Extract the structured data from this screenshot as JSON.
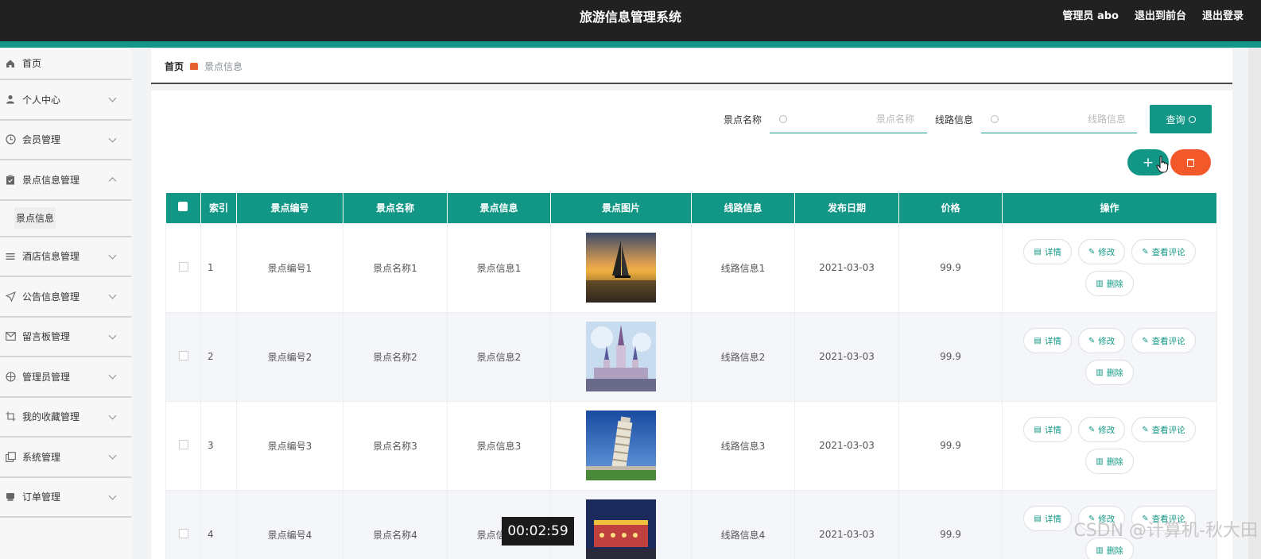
{
  "header": {
    "title": "旅游信息管理系统",
    "user_label": "管理员 abo",
    "front_label": "退出到前台",
    "logout_label": "退出登录"
  },
  "sidebar": {
    "items": [
      {
        "label": "首页",
        "icon": "home-icon"
      },
      {
        "label": "个人中心",
        "icon": "user-icon"
      },
      {
        "label": "会员管理",
        "icon": "clock-icon"
      },
      {
        "label": "景点信息管理",
        "icon": "clipboard-icon"
      },
      {
        "label": "酒店信息管理",
        "icon": "list-icon"
      },
      {
        "label": "公告信息管理",
        "icon": "send-icon"
      },
      {
        "label": "留言板管理",
        "icon": "mail-icon"
      },
      {
        "label": "管理员管理",
        "icon": "compass-icon"
      },
      {
        "label": "我的收藏管理",
        "icon": "crop-icon"
      },
      {
        "label": "系统管理",
        "icon": "copy-icon"
      },
      {
        "label": "订单管理",
        "icon": "printer-icon"
      }
    ],
    "submenu": {
      "label": "景点信息"
    }
  },
  "breadcrumb": {
    "home": "首页",
    "current": "景点信息"
  },
  "search": {
    "name_label": "景点名称",
    "name_placeholder": "景点名称",
    "route_label": "线路信息",
    "route_placeholder": "线路信息",
    "query_label": "查询"
  },
  "toolbar": {
    "add_label": "+"
  },
  "table": {
    "headers": [
      "索引",
      "景点编号",
      "景点名称",
      "景点信息",
      "景点图片",
      "线路信息",
      "发布日期",
      "价格",
      "操作"
    ],
    "rows": [
      {
        "index": "1",
        "code": "景点编号1",
        "name": "景点名称1",
        "info": "景点信息1",
        "image": "sunset-sailboat",
        "route": "线路信息1",
        "date": "2021-03-03",
        "price": "99.9"
      },
      {
        "index": "2",
        "code": "景点编号2",
        "name": "景点名称2",
        "info": "景点信息2",
        "image": "castle",
        "route": "线路信息2",
        "date": "2021-03-03",
        "price": "99.9"
      },
      {
        "index": "3",
        "code": "景点编号3",
        "name": "景点名称3",
        "info": "景点信息3",
        "image": "leaning-tower",
        "route": "线路信息3",
        "date": "2021-03-03",
        "price": "99.9"
      },
      {
        "index": "4",
        "code": "景点编号4",
        "name": "景点名称4",
        "info": "景点信息4",
        "image": "night-carousel",
        "route": "线路信息4",
        "date": "2021-03-03",
        "price": "99.9"
      }
    ],
    "actions": {
      "detail": "详情",
      "edit": "修改",
      "comments": "查看评论",
      "delete": "删除"
    }
  },
  "overlay": {
    "timer": "00:02:59",
    "watermark": "CSDN @计算机-秋大田"
  },
  "colors": {
    "accent": "#129786",
    "danger": "#f3582a",
    "header_bg": "#212121"
  }
}
